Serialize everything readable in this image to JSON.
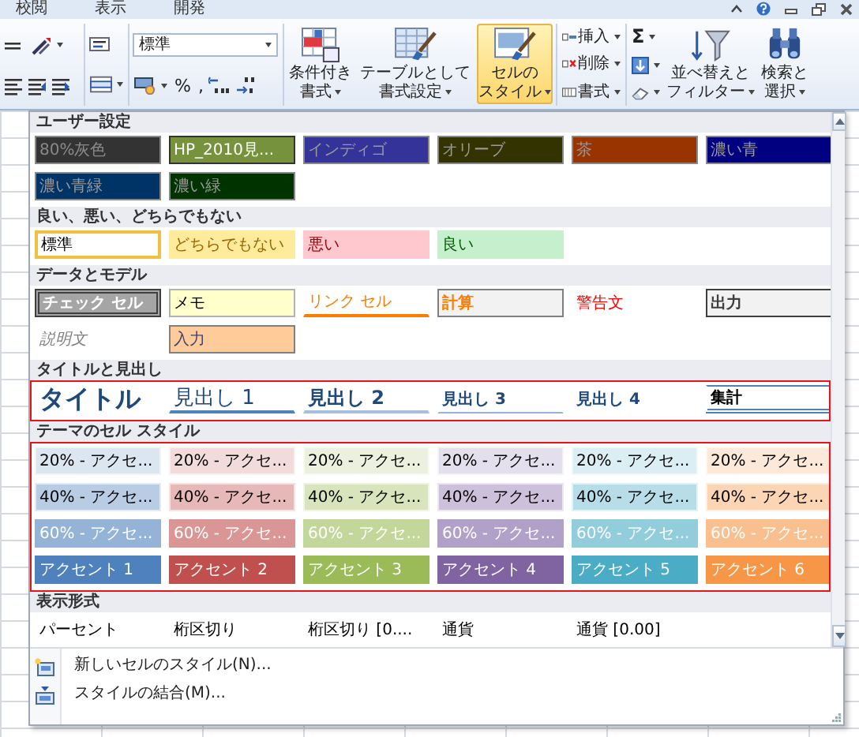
{
  "ribbon": {
    "tabs": [
      {
        "label": "校閲"
      },
      {
        "label": "表示"
      },
      {
        "label": "開発"
      }
    ],
    "number_format": {
      "value": "標準"
    },
    "number_symbols": [
      "%",
      ","
    ],
    "style_buttons": [
      {
        "lines": [
          "条件付き",
          "書式"
        ],
        "selected": false
      },
      {
        "lines": [
          "テーブルとして",
          "書式設定"
        ],
        "selected": false
      },
      {
        "lines": [
          "セルの",
          "スタイル"
        ],
        "selected": true
      }
    ],
    "cell_buttons": [
      {
        "label": "挿入"
      },
      {
        "label": "削除"
      },
      {
        "label": "書式"
      }
    ],
    "sum_label": "Σ",
    "edit_buttons": [
      {
        "lines": [
          "並べ替えと",
          "フィルター"
        ]
      },
      {
        "lines": [
          "検索と",
          "選択"
        ]
      }
    ]
  },
  "sections": [
    {
      "title": "ユーザー設定",
      "cells": [
        {
          "label": "80%灰色",
          "kind": "dim",
          "color": "#333333",
          "selected": false
        },
        {
          "label": "HP_2010見...",
          "kind": "light",
          "color": "#76923c",
          "selected": false
        },
        {
          "label": "インディゴ",
          "kind": "dark",
          "color": "#333399",
          "selected": false
        },
        {
          "label": "オリーブ",
          "kind": "dark",
          "color": "#333300",
          "selected": false
        },
        {
          "label": "茶",
          "kind": "dark",
          "color": "#993300",
          "selected": false
        },
        {
          "label": "濃い青",
          "kind": "dark",
          "color": "#000080",
          "selected": false
        },
        {
          "label": "濃い青緑",
          "kind": "dark",
          "color": "#003366",
          "selected": false
        },
        {
          "label": "濃い緑",
          "kind": "dark",
          "color": "#003300",
          "selected": false
        }
      ]
    },
    {
      "title": "良い、悪い、どちらでもない",
      "cells": [
        {
          "label": "標準",
          "kind": "normal",
          "selected": true
        },
        {
          "label": "どちらでもない",
          "kind": "neutral",
          "selected": false
        },
        {
          "label": "悪い",
          "kind": "bad",
          "selected": false
        },
        {
          "label": "良い",
          "kind": "good",
          "selected": false
        }
      ]
    },
    {
      "title": "データとモデル",
      "cells": [
        {
          "label": "チェック セル",
          "kind": "check",
          "selected": false
        },
        {
          "label": "メモ",
          "kind": "memo",
          "selected": false
        },
        {
          "label": "リンク セル",
          "kind": "link",
          "selected": false
        },
        {
          "label": "計算",
          "kind": "calc",
          "selected": false
        },
        {
          "label": "警告文",
          "kind": "warning",
          "selected": false
        },
        {
          "label": "出力",
          "kind": "output",
          "selected": false
        },
        {
          "label": "説明文",
          "kind": "explanatory",
          "selected": false
        },
        {
          "label": "入力",
          "kind": "input",
          "selected": false
        }
      ]
    },
    {
      "title": "タイトルと見出し",
      "highlighted": true,
      "cells": [
        {
          "label": "タイトル",
          "kind": "title",
          "selected": false
        },
        {
          "label": "見出し 1",
          "kind": "heading1",
          "selected": false
        },
        {
          "label": "見出し 2",
          "kind": "heading2",
          "selected": false
        },
        {
          "label": "見出し 3",
          "kind": "heading3",
          "selected": false
        },
        {
          "label": "見出し 4",
          "kind": "heading4",
          "selected": false
        },
        {
          "label": "集計",
          "kind": "total",
          "selected": false
        }
      ]
    },
    {
      "title": "テーマのセル スタイル",
      "highlighted": true,
      "cells": [
        {
          "label": "20% - アクセ...",
          "kind": "accent20",
          "color": "#dce6f1",
          "selected": false
        },
        {
          "label": "20% - アクセ...",
          "kind": "accent20",
          "color": "#f2dcdb",
          "selected": false
        },
        {
          "label": "20% - アクセ...",
          "kind": "accent20",
          "color": "#ebf1de",
          "selected": false
        },
        {
          "label": "20% - アクセ...",
          "kind": "accent20",
          "color": "#e4dfec",
          "selected": false
        },
        {
          "label": "20% - アクセ...",
          "kind": "accent20",
          "color": "#daeef3",
          "selected": false
        },
        {
          "label": "20% - アクセ...",
          "kind": "accent20",
          "color": "#fde9d9",
          "selected": false
        },
        {
          "label": "40% - アクセ...",
          "kind": "accent40",
          "color": "#b8cce4",
          "selected": false
        },
        {
          "label": "40% - アクセ...",
          "kind": "accent40",
          "color": "#e6b8b7",
          "selected": false
        },
        {
          "label": "40% - アクセ...",
          "kind": "accent40",
          "color": "#d8e4bc",
          "selected": false
        },
        {
          "label": "40% - アクセ...",
          "kind": "accent40",
          "color": "#ccc0da",
          "selected": false
        },
        {
          "label": "40% - アクセ...",
          "kind": "accent40",
          "color": "#b7dee8",
          "selected": false
        },
        {
          "label": "40% - アクセ...",
          "kind": "accent40",
          "color": "#fcd5b4",
          "selected": false
        },
        {
          "label": "60% - アクセ...",
          "kind": "accent60",
          "color": "#95b3d7",
          "selected": false
        },
        {
          "label": "60% - アクセ...",
          "kind": "accent60",
          "color": "#da9694",
          "selected": false
        },
        {
          "label": "60% - アクセ...",
          "kind": "accent60",
          "color": "#c4d79b",
          "selected": false
        },
        {
          "label": "60% - アクセ...",
          "kind": "accent60",
          "color": "#b1a0c7",
          "selected": false
        },
        {
          "label": "60% - アクセ...",
          "kind": "accent60",
          "color": "#92cddc",
          "selected": false
        },
        {
          "label": "60% - アクセ...",
          "kind": "accent60",
          "color": "#fabf8f",
          "selected": false
        },
        {
          "label": "アクセント 1",
          "kind": "accent",
          "color": "#4f81bd",
          "selected": false
        },
        {
          "label": "アクセント 2",
          "kind": "accent",
          "color": "#c0504d",
          "selected": false
        },
        {
          "label": "アクセント 3",
          "kind": "accent",
          "color": "#9bbb59",
          "selected": false
        },
        {
          "label": "アクセント 4",
          "kind": "accent",
          "color": "#8064a2",
          "selected": false
        },
        {
          "label": "アクセント 5",
          "kind": "accent",
          "color": "#4bacc6",
          "selected": false
        },
        {
          "label": "アクセント 6",
          "kind": "accent",
          "color": "#f79646",
          "selected": false
        }
      ]
    },
    {
      "title": "表示形式",
      "cells": [
        {
          "label": "パーセント",
          "kind": "number",
          "selected": false
        },
        {
          "label": "桁区切り",
          "kind": "number",
          "selected": false
        },
        {
          "label": "桁区切り [0....",
          "kind": "number",
          "selected": false
        },
        {
          "label": "通貨",
          "kind": "number",
          "selected": false
        },
        {
          "label": "通貨 [0.00]",
          "kind": "number",
          "selected": false
        }
      ]
    }
  ],
  "menu_items": [
    {
      "label": "新しいセルのスタイル(N)..."
    },
    {
      "label": "スタイルの結合(M)..."
    }
  ]
}
